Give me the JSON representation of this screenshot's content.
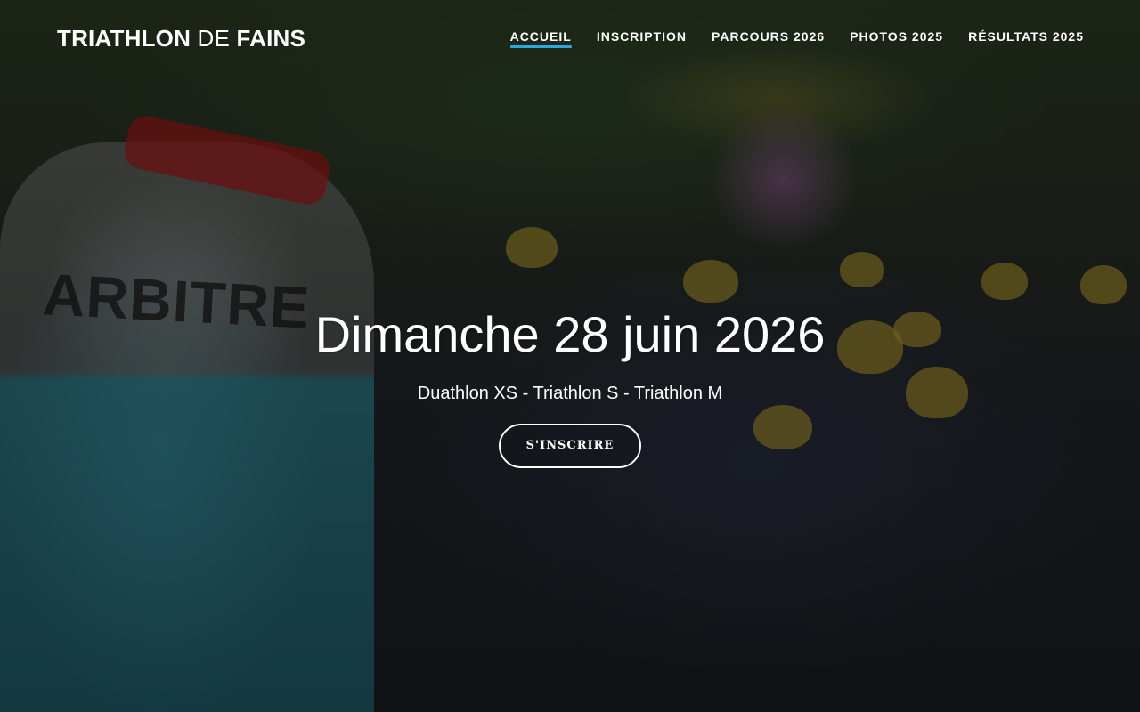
{
  "brand": {
    "part1": "TRIATHLON",
    "part2": "DE",
    "part3": "FAINS"
  },
  "nav": {
    "items": [
      {
        "label": "ACCUEIL",
        "active": true
      },
      {
        "label": "INSCRIPTION",
        "active": false
      },
      {
        "label": "PARCOURS 2026",
        "active": false
      },
      {
        "label": "PHOTOS 2025",
        "active": false
      },
      {
        "label": "RÉSULTATS 2025",
        "active": false
      }
    ]
  },
  "hero": {
    "title": "Dimanche 28 juin 2026",
    "subtitle": "Duathlon XS - Triathlon S - Triathlon M",
    "cta_label": "S'INSCRIRE",
    "photo_text": "ARBITRE"
  },
  "colors": {
    "accent": "#2ba8e0",
    "text": "#ffffff"
  }
}
